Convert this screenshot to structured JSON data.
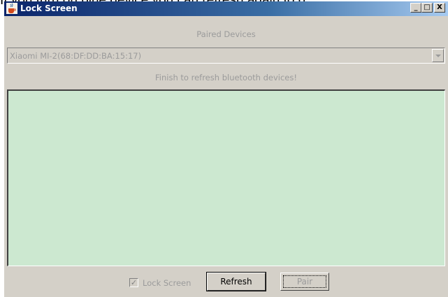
{
  "caption": "If you turn on blue device you can refresh again to g",
  "window": {
    "title": "Lock Screen",
    "controls": {
      "minimize": "_",
      "maximize": "□",
      "close": "X"
    }
  },
  "paired_devices_label": "Paired Devices",
  "device_combo": {
    "selected": "Xiaomi MI-2(68:DF:DD:BA:15:17)"
  },
  "status_text": "Finish to refresh bluetooth devices!",
  "device_list": {
    "items": []
  },
  "footer": {
    "lock_screen_label": "Lock Screen",
    "lock_screen_checked": true,
    "refresh_label": "Refresh",
    "pair_label": "Pair"
  },
  "colors": {
    "title_gradient_start": "#0a246a",
    "title_gradient_end": "#a6caf0",
    "window_bg": "#d4d0c8",
    "list_bg": "#cce8d0",
    "disabled_text": "#9b9b9b"
  },
  "icons": {
    "app": "java-coffee-icon",
    "combo_arrow": "chevron-down-icon",
    "checkbox_mark": "checkmark-icon"
  }
}
